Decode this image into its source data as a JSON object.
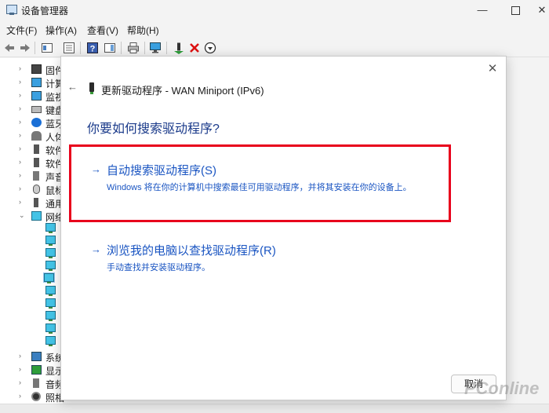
{
  "window": {
    "title": "设备管理器",
    "icon": "device-manager-icon",
    "controls": {
      "minimize": "—",
      "close": "✕"
    }
  },
  "menu": [
    "文件(F)",
    "操作(A)",
    "查看(V)",
    "帮助(H)"
  ],
  "toolbar_icons": [
    "back-arrow-icon",
    "forward-arrow-icon",
    "properties-icon",
    "console-tree-icon",
    "help-icon",
    "action-pane-icon",
    "print-icon",
    "scan-hardware-icon",
    "enable-device-icon",
    "uninstall-x-icon",
    "update-driver-down-icon"
  ],
  "tree": [
    {
      "label": "固件",
      "arrow": "›",
      "icon": "firmware-icon"
    },
    {
      "label": "计算",
      "arrow": "›",
      "icon": "computer-icon"
    },
    {
      "label": "监视",
      "arrow": "›",
      "icon": "monitor-icon"
    },
    {
      "label": "键盘",
      "arrow": "›",
      "icon": "keyboard-icon"
    },
    {
      "label": "蓝牙",
      "arrow": "›",
      "icon": "bluetooth-icon"
    },
    {
      "label": "人体",
      "arrow": "›",
      "icon": "hid-icon"
    },
    {
      "label": "软件",
      "arrow": "›",
      "icon": "software-component-icon"
    },
    {
      "label": "软件",
      "arrow": "›",
      "icon": "software-device-icon"
    },
    {
      "label": "声音",
      "arrow": "›",
      "icon": "speaker-icon"
    },
    {
      "label": "鼠标",
      "arrow": "›",
      "icon": "mouse-icon"
    },
    {
      "label": "通用",
      "arrow": "›",
      "icon": "usb-icon"
    },
    {
      "label": "网络",
      "arrow": "⌄",
      "icon": "network-adapter-icon"
    }
  ],
  "tree_bottom": [
    {
      "label": "系统",
      "arrow": "›",
      "icon": "system-icon"
    },
    {
      "label": "显示",
      "arrow": "›",
      "icon": "display-adapter-icon"
    },
    {
      "label": "音频",
      "arrow": "›",
      "icon": "audio-icon"
    },
    {
      "label": "照相",
      "arrow": "›",
      "icon": "camera-icon"
    }
  ],
  "dialog": {
    "close": "✕",
    "back": "←",
    "title": "更新驱动程序 - WAN Miniport (IPv6)",
    "heading": "你要如何搜索驱动程序?",
    "option_arrow": "→",
    "auto": {
      "title": "自动搜索驱动程序(S)",
      "desc": "Windows 将在你的计算机中搜索最佳可用驱动程序，并将其安装在你的设备上。"
    },
    "browse": {
      "title": "浏览我的电脑以查找驱动程序(R)",
      "desc": "手动查找并安装驱动程序。"
    },
    "cancel": "取消"
  },
  "watermark": "PConline",
  "colors": {
    "link": "#1a55c2",
    "highlight": "#e8001c",
    "heading": "#1a3a8a"
  }
}
